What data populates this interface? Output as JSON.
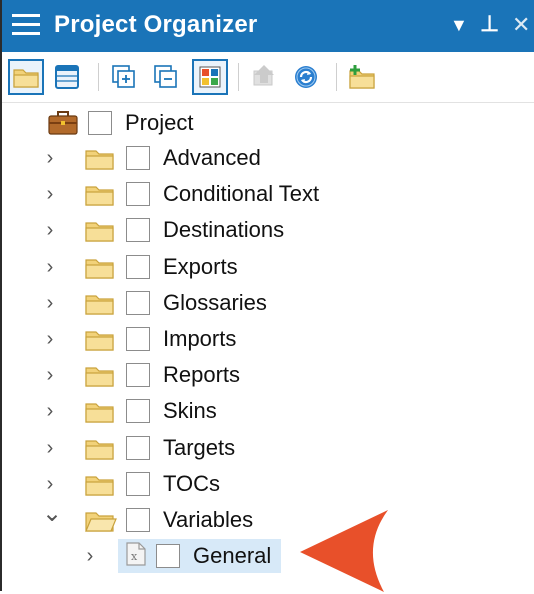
{
  "window": {
    "title": "Project Organizer"
  },
  "title_controls": [
    "▼",
    "⊥",
    "✕"
  ],
  "toolbar": {
    "buttons": [
      {
        "name": "open-folder-button",
        "icon": "folder-icon",
        "active": true
      },
      {
        "name": "table-view-button",
        "icon": "table-icon",
        "active": false
      },
      {
        "name": "expand-all-button",
        "icon": "expand-all-icon",
        "active": false
      },
      {
        "name": "collapse-all-button",
        "icon": "collapse-all-icon",
        "active": false
      },
      {
        "name": "color-view-button",
        "icon": "color-grid-icon",
        "active": true
      },
      {
        "name": "publish-button",
        "icon": "publish-icon",
        "active": false
      },
      {
        "name": "refresh-button",
        "icon": "refresh-icon",
        "active": false
      },
      {
        "name": "new-folder-button",
        "icon": "new-folder-icon",
        "active": false
      }
    ]
  },
  "tree": {
    "root": {
      "label": "Project",
      "icon": "briefcase-icon"
    },
    "items": [
      {
        "label": "Advanced",
        "state": "collapsed"
      },
      {
        "label": "Conditional Text",
        "state": "collapsed"
      },
      {
        "label": "Destinations",
        "state": "collapsed"
      },
      {
        "label": "Exports",
        "state": "collapsed"
      },
      {
        "label": "Glossaries",
        "state": "collapsed"
      },
      {
        "label": "Imports",
        "state": "collapsed"
      },
      {
        "label": "Reports",
        "state": "collapsed"
      },
      {
        "label": "Skins",
        "state": "collapsed"
      },
      {
        "label": "Targets",
        "state": "collapsed"
      },
      {
        "label": "TOCs",
        "state": "collapsed"
      },
      {
        "label": "Variables",
        "state": "expanded"
      }
    ],
    "child": {
      "label": "General",
      "icon": "variable-file-icon",
      "selected": true
    }
  },
  "colors": {
    "accent": "#1a74b8",
    "selection": "#d7e9f8",
    "pointer": "#e8502a"
  }
}
